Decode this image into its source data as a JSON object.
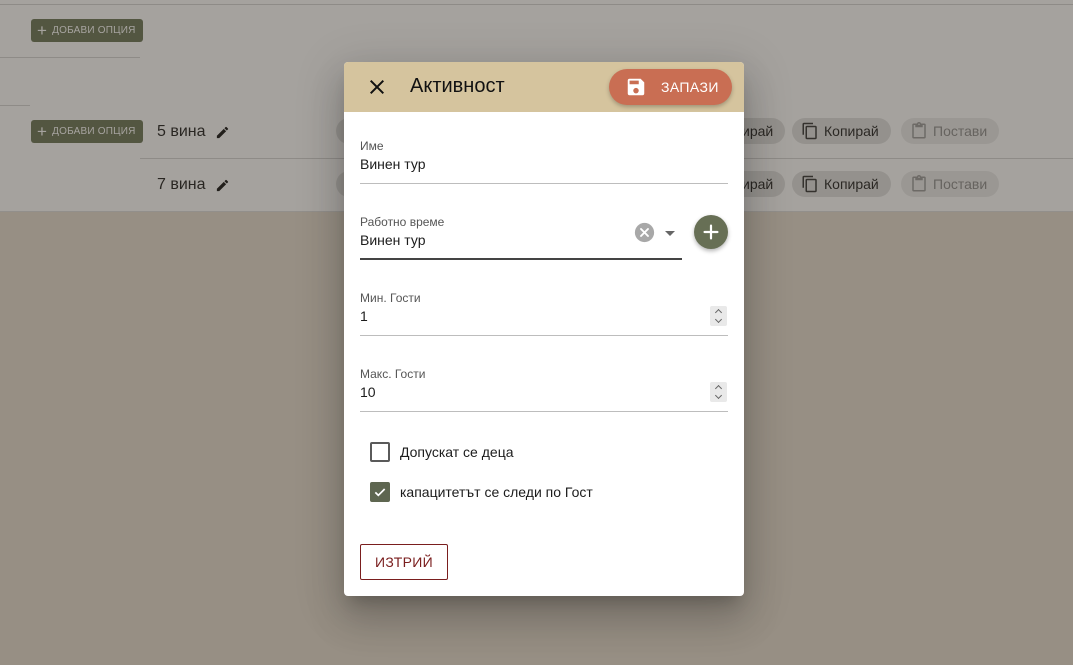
{
  "background": {
    "add_option_label": "ДОБАВИ ОПЦИЯ",
    "rows": [
      {
        "name": "5 вина",
        "copy_label": "Копирай",
        "paste_label": "Постави",
        "partial_label": "ирай"
      },
      {
        "name": "7 вина",
        "copy_label": "Копирай",
        "paste_label": "Постави",
        "partial_label": "ирай"
      }
    ]
  },
  "dialog": {
    "title": "Активност",
    "save_label": "ЗАПАЗИ",
    "fields": {
      "name": {
        "label": "Име",
        "value": "Винен тур"
      },
      "schedule": {
        "label": "Работно време",
        "value": "Винен тур"
      },
      "min_guests": {
        "label": "Мин. Гости",
        "value": "1"
      },
      "max_guests": {
        "label": "Макс. Гости",
        "value": "10"
      }
    },
    "checkboxes": {
      "children_allowed": {
        "label": "Допускат се деца",
        "checked": false
      },
      "capacity_per_guest": {
        "label": "капацитетът се следи по Гост",
        "checked": true
      }
    },
    "delete_label": "ИЗТРИЙ"
  },
  "colors": {
    "header_bg": "#d5c49e",
    "save_button": "#c96e53",
    "accent_green": "#676f55",
    "delete_text": "#7a1e1e"
  },
  "icons": {
    "close": "close-icon",
    "save": "floppy-disk-icon",
    "clear": "clear-circle-icon",
    "add": "plus-icon",
    "edit": "pencil-icon",
    "copy": "copy-icon",
    "paste": "clipboard-icon"
  }
}
